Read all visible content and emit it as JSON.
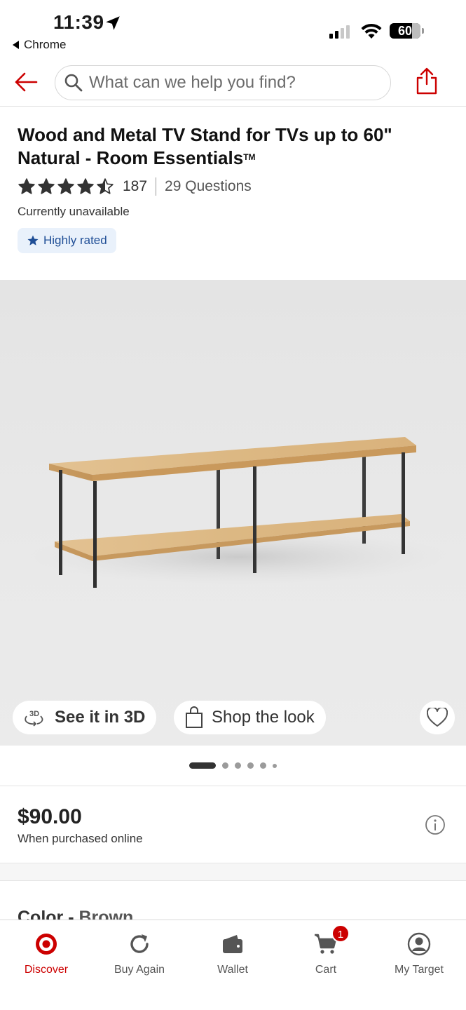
{
  "status_bar": {
    "time": "11:39",
    "back_app": "Chrome",
    "battery": "60"
  },
  "search": {
    "placeholder": "What can we help you find?"
  },
  "product": {
    "title_line1": "Wood and Metal TV Stand for TVs up to 60\"",
    "title_line2": "Natural - Room Essentials",
    "trademark": "TM",
    "rating_value": 4.5,
    "rating_count": "187",
    "questions": "29 Questions",
    "availability": "Currently unavailable",
    "badge": "Highly rated"
  },
  "gallery": {
    "see_3d": "See it in 3D",
    "shop_look": "Shop the look",
    "icon_3d_label": "3D",
    "image_count": 6,
    "active_index": 0
  },
  "pricing": {
    "price": "$90.00",
    "note": "When purchased online"
  },
  "variant": {
    "label": "Color - ",
    "value": "Brown"
  },
  "tabbar": {
    "items": [
      {
        "label": "Discover",
        "icon": "target-logo-icon",
        "active": true
      },
      {
        "label": "Buy Again",
        "icon": "refresh-icon",
        "active": false
      },
      {
        "label": "Wallet",
        "icon": "wallet-icon",
        "active": false
      },
      {
        "label": "Cart",
        "icon": "cart-icon",
        "active": false,
        "badge": "1"
      },
      {
        "label": "My Target",
        "icon": "account-icon",
        "active": false
      }
    ]
  },
  "colors": {
    "brand_red": "#cc0000",
    "badge_bg": "#e9f1fb",
    "badge_text": "#1f4e96"
  }
}
